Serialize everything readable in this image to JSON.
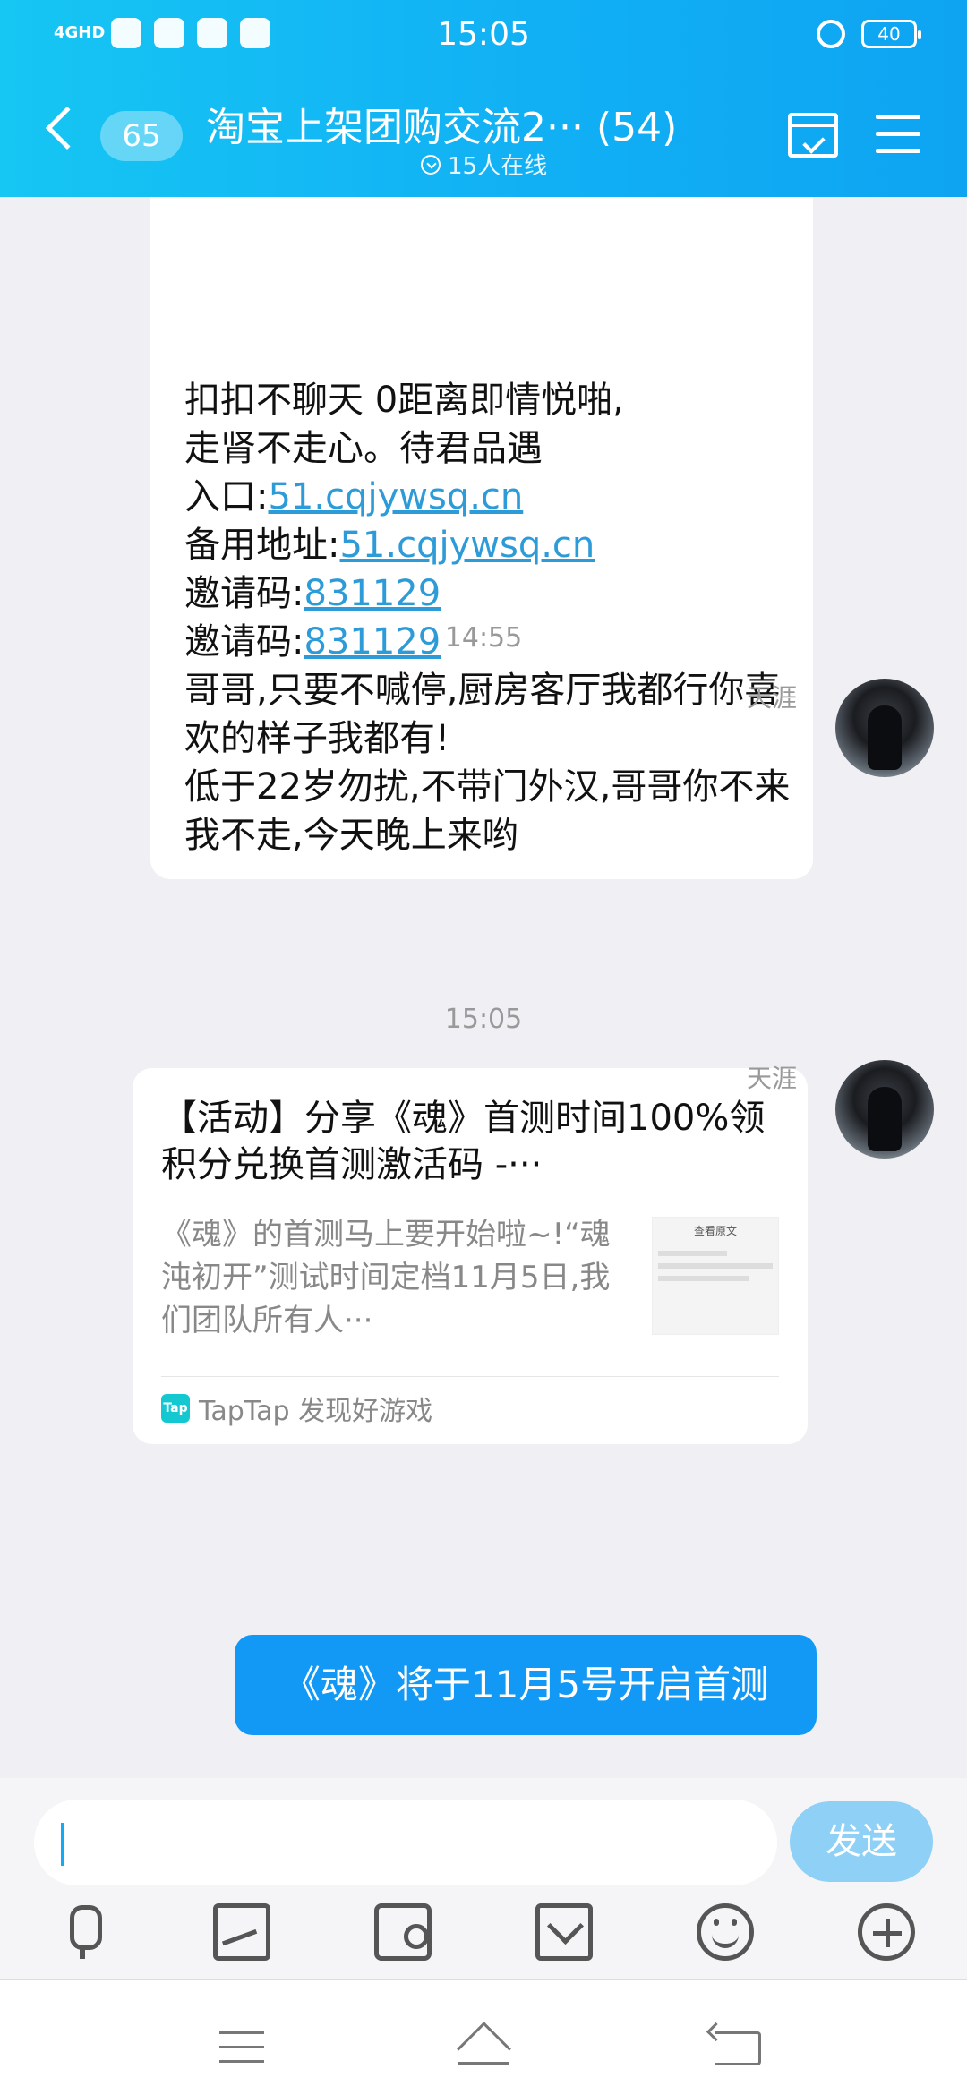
{
  "status_bar": {
    "network": "4GHD",
    "time": "15:05",
    "battery": "40"
  },
  "header": {
    "unread_count": "65",
    "title": "淘宝上架团购交流2··· (54)",
    "online_status": "15人在线"
  },
  "messages": {
    "top_message": {
      "line1": "扣扣不聊天  0距离即情悦啪,",
      "line2": "走肾不走心。待君品遇",
      "entry_label": "入口:",
      "entry_link": "51.cqjywsq.cn",
      "backup_label": "备用地址:",
      "backup_link": "51.cqjywsq.cn",
      "invite_label1": "邀请码:",
      "invite_code1": "831129",
      "invite_label2": "邀请码:",
      "invite_code2": "831129",
      "line7": "哥哥,只要不喊停,厨房客厅我都行你喜欢的样子我都有!",
      "line8": "低于22岁勿扰,不带门外汉,哥哥你不来我不走,今天晚上来哟"
    },
    "timestamp1": "14:55",
    "sender1": "天涯",
    "share_card": {
      "title": "【活动】分享《魂》首测时间100%领积分兑换首测激活码 -···",
      "description": "《魂》的首测马上要开始啦~!“魂沌初开”测试时间定档11月5日,我们团队所有人···",
      "thumbnail_title": "查看原文",
      "source": "TapTap 发现好游戏",
      "source_icon_text": "Tap"
    },
    "timestamp2": "15:05",
    "sender2": "天涯",
    "my_message": "《魂》将于11月5号开启首测"
  },
  "input": {
    "value": "",
    "send_label": "发送"
  },
  "colors": {
    "header_gradient_start": "#16c6f3",
    "header_gradient_end": "#0ea4f2",
    "my_bubble": "#1298f5",
    "send_button": "#8fd0f6",
    "link": "#2c9bd8"
  },
  "icons": [
    "back-icon",
    "calendar-icon",
    "menu-icon",
    "mic-icon",
    "image-icon",
    "camera-icon",
    "red-packet-icon",
    "emoji-icon",
    "plus-icon"
  ]
}
